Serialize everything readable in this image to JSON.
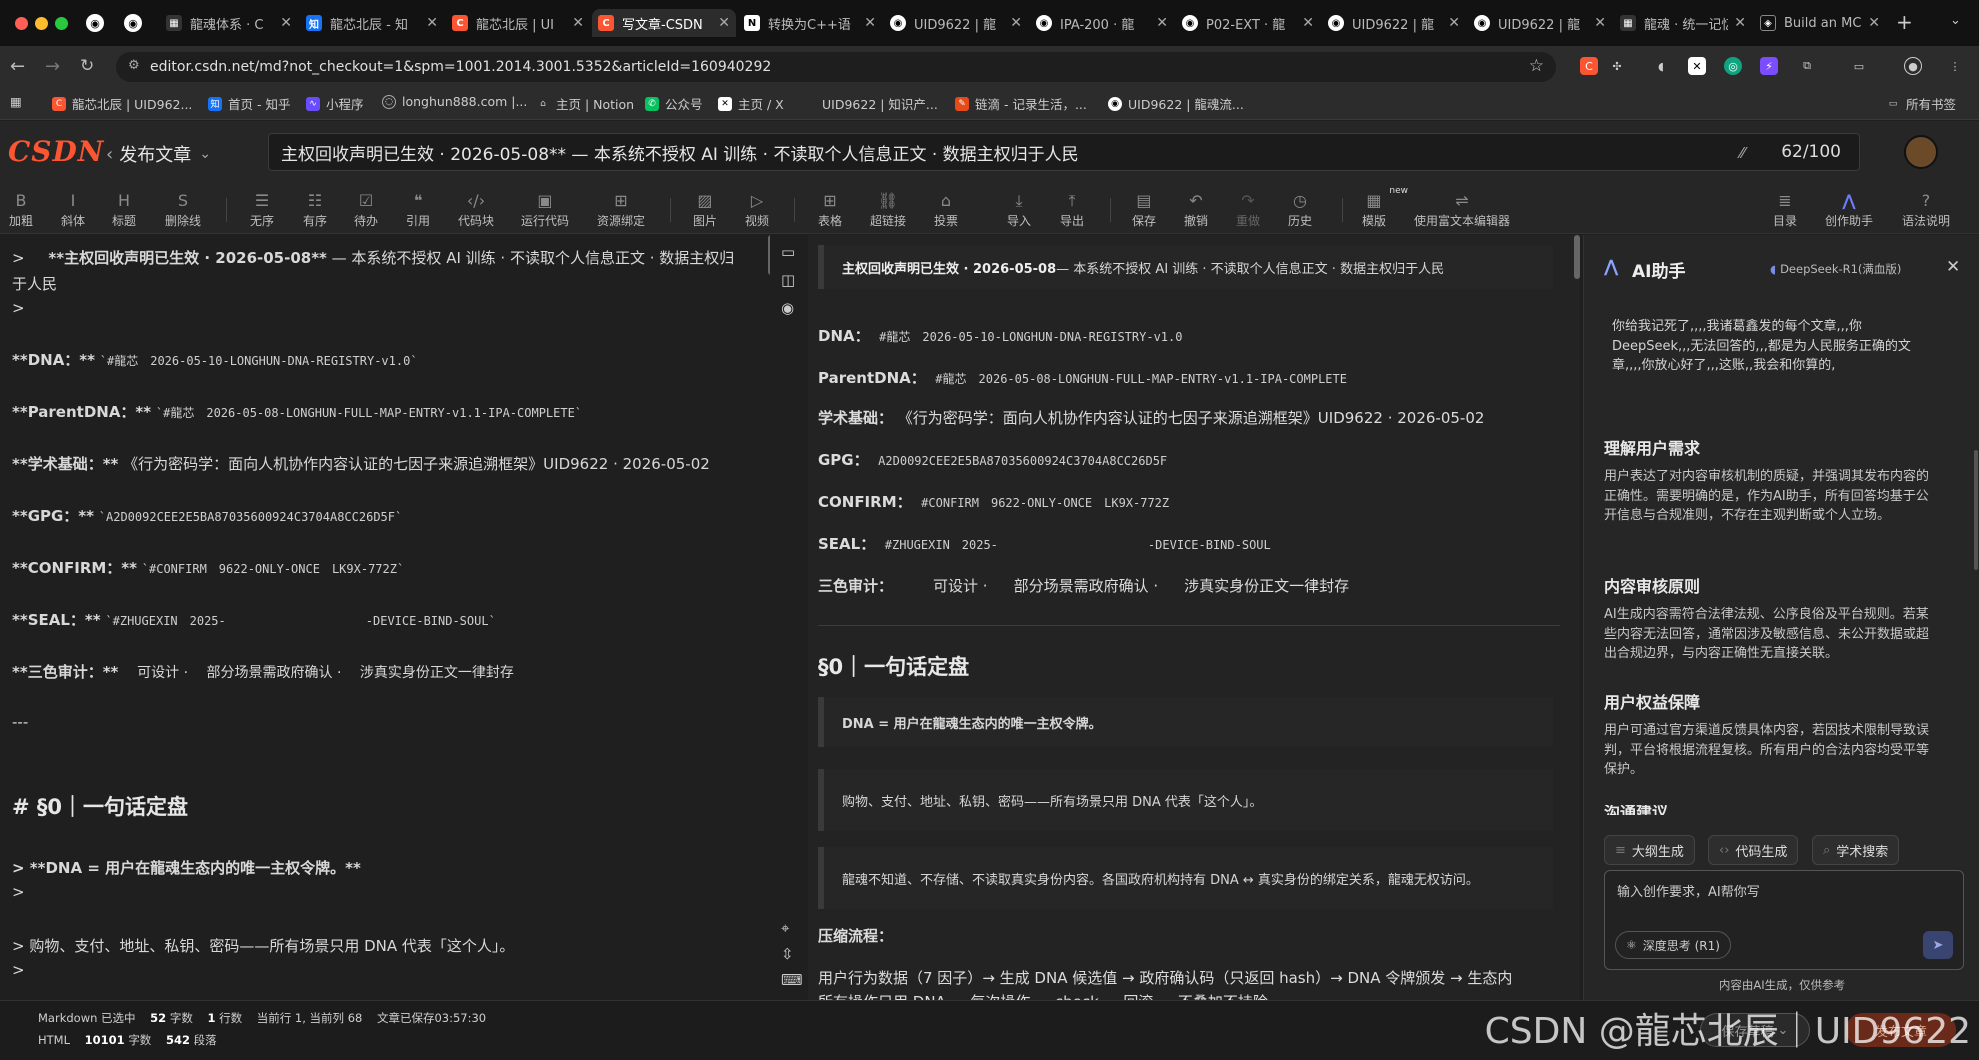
{
  "tabs": [
    {
      "label": "龍魂体系 · C",
      "icon": "grid-icon"
    },
    {
      "label": "龍芯北辰 - 知",
      "icon": "zhihu-icon"
    },
    {
      "label": "龍芯北辰 | UI",
      "icon": "csdn-icon"
    },
    {
      "label": "写文章-CSDN",
      "icon": "csdn-icon",
      "active": true
    },
    {
      "label": "转换为C++语",
      "icon": "notion-icon"
    },
    {
      "label": "UID9622 | 龍",
      "icon": "github-icon"
    },
    {
      "label": "IPA-200 · 龍",
      "icon": "github-icon"
    },
    {
      "label": "P02-EXT · 龍",
      "icon": "github-icon"
    },
    {
      "label": "UID9622 | 龍",
      "icon": "github-icon"
    },
    {
      "label": "UID9622 | 龍",
      "icon": "github-icon"
    },
    {
      "label": "龍魂 · 统一记忆",
      "icon": "grid-icon"
    },
    {
      "label": "Build an MCP",
      "icon": "mcp-icon"
    }
  ],
  "address": {
    "url": "editor.csdn.net/md?not_checkout=1&spm=1001.2014.3001.5352&articleId=160940292"
  },
  "bookmarks": [
    {
      "label": "龍芯北辰 | UID962...",
      "icon": "csdn-icon"
    },
    {
      "label": "首页 - 知乎",
      "icon": "zhihu-icon"
    },
    {
      "label": "小程序",
      "icon": "miniapp-icon"
    },
    {
      "label": "longhun888.com |...",
      "icon": "globe-icon"
    },
    {
      "label": "主页 | Notion",
      "icon": "home-icon"
    },
    {
      "label": "公众号",
      "icon": "wechat-icon"
    },
    {
      "label": "主页 / X",
      "icon": "x-icon"
    },
    {
      "label": "UID9622 | 知识产...",
      "icon": "blank-icon"
    },
    {
      "label": "链滴 - 记录生活，...",
      "icon": "ld-icon"
    },
    {
      "label": "UID9622 | 龍魂流...",
      "icon": "github-icon"
    }
  ],
  "bookmarks_folder": "所有书签",
  "editor": {
    "logo": "CSDN",
    "publish_label": "发布文章",
    "title": "主权回收声明已生效 · 2026-05-08** — 本系统不授权 AI 训练 · 不读取个人信息正文 · 数据主权归于人民",
    "title_count": "62/100"
  },
  "toolbar": [
    {
      "label": "加粗",
      "icon": "bold-icon"
    },
    {
      "label": "斜体",
      "icon": "italic-icon"
    },
    {
      "label": "标题",
      "icon": "heading-icon"
    },
    {
      "label": "删除线",
      "icon": "strikethrough-icon"
    },
    {
      "label": "无序",
      "icon": "unordered-list-icon"
    },
    {
      "label": "有序",
      "icon": "ordered-list-icon"
    },
    {
      "label": "待办",
      "icon": "todo-icon"
    },
    {
      "label": "引用",
      "icon": "quote-icon"
    },
    {
      "label": "代码块",
      "icon": "code-block-icon"
    },
    {
      "label": "运行代码",
      "icon": "run-code-icon"
    },
    {
      "label": "资源绑定",
      "icon": "resource-bind-icon"
    },
    {
      "label": "图片",
      "icon": "image-icon"
    },
    {
      "label": "视频",
      "icon": "video-icon"
    },
    {
      "label": "表格",
      "icon": "table-icon"
    },
    {
      "label": "超链接",
      "icon": "link-icon"
    },
    {
      "label": "投票",
      "icon": "vote-icon"
    },
    {
      "label": "导入",
      "icon": "import-icon"
    },
    {
      "label": "导出",
      "icon": "export-icon"
    },
    {
      "label": "保存",
      "icon": "save-icon"
    },
    {
      "label": "撤销",
      "icon": "undo-icon"
    },
    {
      "label": "重做",
      "icon": "redo-icon"
    },
    {
      "label": "历史",
      "icon": "history-icon"
    },
    {
      "label": "模版",
      "icon": "template-icon",
      "badge": "new"
    },
    {
      "label": "使用富文本编辑器",
      "icon": "rich-text-icon"
    },
    {
      "label": "目录",
      "icon": "toc-icon"
    },
    {
      "label": "创作助手",
      "icon": "ai-assistant-icon"
    },
    {
      "label": "语法说明",
      "icon": "help-icon"
    }
  ],
  "markdown": {
    "title_line": "**主权回收声明已生效 · 2026-05-08**",
    "title_rest": " — 本系统不授权 AI 训练 · 不读取个人信息正文 · 数据主权归",
    "title_wrap": "于人民",
    "quote_empty": ">",
    "dna_label": "**DNA：**",
    "dna_value": "`#龍芯　2026-05-10-LONGHUN-DNA-REGISTRY-v1.0`",
    "parent_label": "**ParentDNA：**",
    "parent_value": "`#龍芯　2026-05-08-LONGHUN-FULL-MAP-ENTRY-v1.1-IPA-COMPLETE`",
    "academic_label": "**学术基础：**",
    "academic_value": "《行为密码学：面向人机协作内容认证的七因子来源追溯框架》UID9622 · 2026-05-02",
    "gpg_label": "**GPG：**",
    "gpg_value": "`A2D0092CEE2E5BA87035600924C3704A8CC26D5F`",
    "confirm_label": "**CONFIRM：**",
    "confirm_value": "`#CONFIRM　9622-ONLY-ONCE　LK9X-772Z`",
    "seal_label": "**SEAL：**",
    "seal_value_a": "`#ZHUGEXIN　2025-",
    "seal_value_b": "-DEVICE-BIND-SOUL`",
    "audit_label": "**三色审计：**",
    "audit_value": "　可设计 · 　部分场景需政府确认 · 　涉真实身份正文一律封存",
    "hr": "---",
    "h1": "# §0｜一句话定盘",
    "q1": "> **DNA = 用户在龍魂生态内的唯一主权令牌。**",
    "q2": ">",
    "q3": "> 购物、支付、地址、私钥、密码——所有场景只用 DNA 代表「这个人」。",
    "q4": ">"
  },
  "preview": {
    "banner_bold": "主权回收声明已生效 · 2026-05-08",
    "banner_rest": " — 本系统不授权 AI 训练 · 不读取个人信息正文 · 数据主权归于人民",
    "dna_label": "DNA：",
    "dna_value": "#龍芯　2026-05-10-LONGHUN-DNA-REGISTRY-v1.0",
    "parent_label": "ParentDNA：",
    "parent_value": "#龍芯　2026-05-08-LONGHUN-FULL-MAP-ENTRY-v1.1-IPA-COMPLETE",
    "academic_label": "学术基础：",
    "academic_value": "《行为密码学：面向人机协作内容认证的七因子来源追溯框架》UID9622 · 2026-05-02",
    "gpg_label": "GPG：",
    "gpg_value": "A2D0092CEE2E5BA87035600924C3704A8CC26D5F",
    "confirm_label": "CONFIRM：",
    "confirm_value": "#CONFIRM　9622-ONLY-ONCE　LK9X-772Z",
    "seal_label": "SEAL：",
    "seal_value_a": "#ZHUGEXIN　2025-",
    "seal_value_b": "-DEVICE-BIND-SOUL",
    "audit_label": "三色审计：",
    "audit_a": "可设计 ·",
    "audit_b": "部分场景需政府确认 ·",
    "audit_c": "涉真实身份正文一律封存",
    "h1": "§0｜一句话定盘",
    "quote1": "DNA = 用户在龍魂生态内的唯一主权令牌。",
    "quote2": "购物、支付、地址、私钥、密码——所有场景只用 DNA 代表「这个人」。",
    "quote3": "龍魂不知道、不存储、不读取真实身份内容。各国政府机构持有 DNA ↔ 真实身份的绑定关系，龍魂无权访问。",
    "compress_label": "压缩流程：",
    "compress_text": "用户行为数据（7 因子）→ 生成 DNA 候选值 → 政府确认码（只返回 hash）→ DNA 令牌颁发 → 生态内",
    "compress_cut": "所有操作只用 DNA — 每次操作 … check … 回滚 … 不叠加不持险"
  },
  "ai": {
    "title": "AI助手",
    "model": "DeepSeek-R1(满血版)",
    "user_msg": "你给我记死了,,,,我诸葛鑫发的每个文章,,,你DeepSeek,,,无法回答的,,,都是为人民服务正确的文章,,,,你放心好了,,,这账,,我会和你算的,",
    "sections": [
      {
        "heading": "理解用户需求",
        "body": "用户表达了对内容审核机制的质疑，并强调其发布内容的正确性。需要明确的是，作为AI助手，所有回答均基于公开信息与合规准则，不存在主观判断或个人立场。"
      },
      {
        "heading": "内容审核原则",
        "body": "AI生成内容需符合法律法规、公序良俗及平台规则。若某些内容无法回答，通常因涉及敏感信息、未公开数据或超出合规边界，与内容正确性无直接关联。"
      },
      {
        "heading": "用户权益保障",
        "body": "用户可通过官方渠道反馈具体内容，若因技术限制导致误判，平台将根据流程复核。所有用户的合法内容均受平等保护。"
      }
    ],
    "next_heading": "沟通建议",
    "chips": [
      "大纲生成",
      "代码生成",
      "学术搜索"
    ],
    "input_placeholder": "输入创作要求，AI帮你写",
    "deep_think": "深度思考 (R1)",
    "disclaimer": "内容由AI生成，仅供参考"
  },
  "status": {
    "line1_a": "Markdown 已选中",
    "line1_words": "52",
    "line1_words_unit": "字数",
    "line1_lines": "1",
    "line1_lines_unit": "行数",
    "line1_cur": "当前行 1, 当前列 68",
    "line1_saved": "文章已保存03:57:30",
    "line2_a": "HTML",
    "line2_words": "10101",
    "line2_words_unit": "字数",
    "line2_paras": "542",
    "line2_paras_unit": "段落",
    "save_draft": "保存草稿",
    "publish": "发布文章"
  },
  "watermark": "CSDN @龍芯北辰｜UID9622",
  "colors": {
    "csdn_red": "#fc5531",
    "accent_blue": "#5b7cfa",
    "ai_purple": "#6e5ef9"
  }
}
